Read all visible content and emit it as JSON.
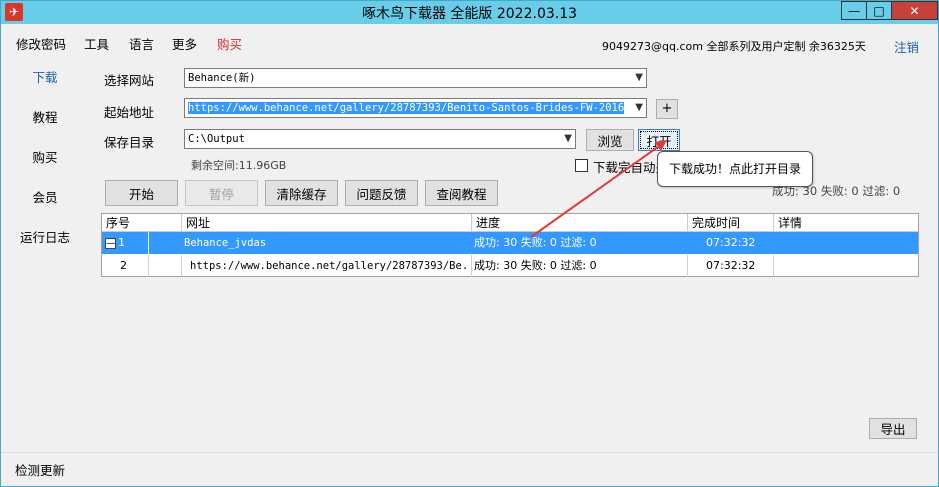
{
  "window": {
    "title": "啄木鸟下载器 全能版 2022.03.13",
    "app_icon": "woodpecker-logo",
    "min_glyph": "—",
    "max_glyph": "□",
    "close_glyph": "✕"
  },
  "menu": {
    "items": [
      "修改密码",
      "工具",
      "语言",
      "更多",
      "购买"
    ],
    "buy_color": "#d32f2f"
  },
  "account": {
    "info": "9049273@qq.com 全部系列及用户定制 余36325天",
    "logout": "注销"
  },
  "nav": {
    "items": [
      "下载",
      "教程",
      "购买",
      "会员",
      "运行日志"
    ],
    "active_color": "#1a5fb4"
  },
  "form": {
    "site_label": "选择网站",
    "site_value": "Behance(新)",
    "url_label": "起始地址",
    "url_value": "https://www.behance.net/gallery/28787393/Benito-Santos-Brides-FW-2016",
    "add_label": "+",
    "dir_label": "保存目录",
    "dir_value": "C:\\Output",
    "browse_label": "浏览",
    "open_label": "打开",
    "free_space": "剩余空间:11.96GB",
    "auto_open_label": "下载完自动关"
  },
  "actions": {
    "start": "开始",
    "pause": "暂停",
    "clear_cache": "清除缓存",
    "feedback": "问题反馈",
    "tutorial": "查阅教程"
  },
  "stats": {
    "text": "成功: 30 失败: 0 过滤: 0"
  },
  "tooltip": {
    "text": "下载成功！点此打开目录"
  },
  "table": {
    "headers": [
      "序号",
      "网址",
      "进度",
      "完成时间",
      "详情"
    ],
    "rows": [
      {
        "index": "1",
        "expander": "—",
        "url": "Behance_jvdas",
        "progress": "成功: 30 失败: 0 过滤: 0",
        "time": "07:32:32",
        "detail": ""
      },
      {
        "index": "2",
        "url": "https://www.behance.net/gallery/28787393/Be...",
        "progress": "成功: 30 失败: 0 过滤: 0",
        "time": "07:32:32",
        "detail": ""
      }
    ],
    "selected_color": "#3399ff"
  },
  "export_label": "导出",
  "status": {
    "text": "检测更新"
  },
  "colors": {
    "titlebar": "#67cde9",
    "annotation_arrow": "#e53935"
  }
}
